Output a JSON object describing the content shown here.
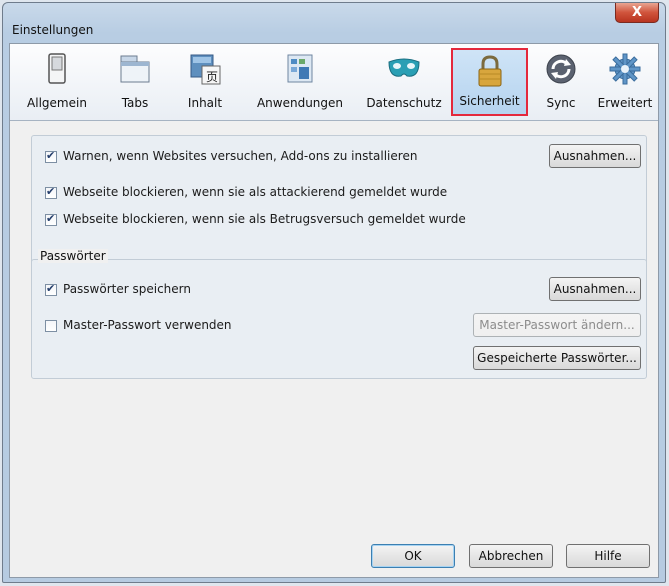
{
  "window": {
    "title": "Einstellungen",
    "close_glyph": "X"
  },
  "toolbar": {
    "items": [
      {
        "label": "Allgemein",
        "icon": "switch-icon"
      },
      {
        "label": "Tabs",
        "icon": "tabs-icon"
      },
      {
        "label": "Inhalt",
        "icon": "content-icon"
      },
      {
        "label": "Anwendungen",
        "icon": "applications-icon"
      },
      {
        "label": "Datenschutz",
        "icon": "mask-icon"
      },
      {
        "label": "Sicherheit",
        "icon": "lock-icon",
        "selected": true
      },
      {
        "label": "Sync",
        "icon": "sync-icon"
      },
      {
        "label": "Erweitert",
        "icon": "gear-icon"
      }
    ]
  },
  "security": {
    "warn_addons": {
      "label": "Warnen, wenn Websites versuchen, Add-ons zu installieren",
      "checked": true
    },
    "exceptions_button": "Ausnahmen...",
    "block_attack": {
      "label": "Webseite blockieren, wenn sie als attackierend gemeldet wurde",
      "checked": true
    },
    "block_forgery": {
      "label": "Webseite blockieren, wenn sie als Betrugsversuch gemeldet wurde",
      "checked": true
    }
  },
  "passwords": {
    "legend": "Passwörter",
    "save": {
      "label": "Passwörter speichern",
      "checked": true
    },
    "exceptions_button": "Ausnahmen...",
    "master": {
      "label": "Master-Passwort verwenden",
      "checked": false
    },
    "change_master_button": "Master-Passwort ändern...",
    "saved_passwords_button": "Gespeicherte Passwörter..."
  },
  "footer": {
    "ok": "OK",
    "cancel": "Abbrechen",
    "help": "Hilfe"
  },
  "colors": {
    "selection_outline": "#e4283c",
    "selected_tab_bg": "#b5d3ef"
  }
}
